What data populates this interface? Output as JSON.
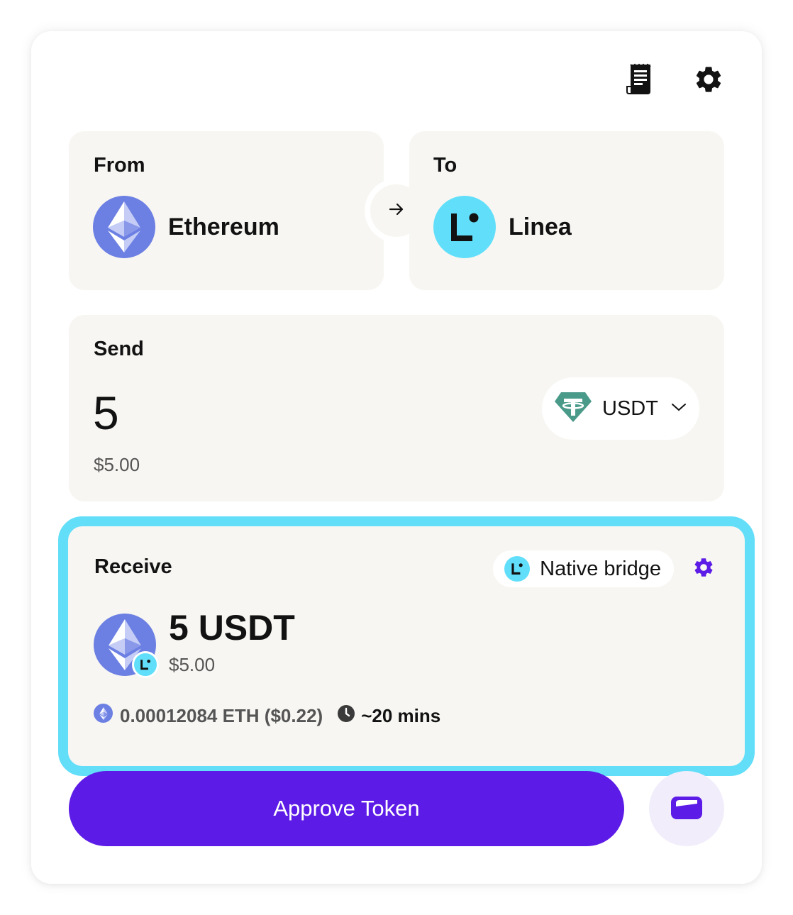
{
  "header": {
    "history_icon": "receipt-icon",
    "settings_icon": "gear-icon"
  },
  "from": {
    "label": "From",
    "chain_name": "Ethereum",
    "chain_icon": "ethereum-logo-icon"
  },
  "swap": {
    "icon": "arrow-right-icon"
  },
  "to": {
    "label": "To",
    "chain_name": "Linea",
    "chain_icon": "linea-logo-icon"
  },
  "send": {
    "label": "Send",
    "amount": "5",
    "usd_value": "$5.00",
    "token_symbol": "USDT",
    "token_icon": "tether-logo-icon",
    "dropdown_icon": "chevron-down-icon"
  },
  "receive": {
    "label": "Receive",
    "route_name": "Native bridge",
    "route_icon": "linea-logo-icon",
    "route_settings_icon": "gear-icon",
    "amount": "5 USDT",
    "usd_value": "$5.00",
    "fee": "0.00012084 ETH ($0.22)",
    "fee_icon": "ethereum-logo-icon",
    "eta": "~20 mins",
    "eta_icon": "clock-icon"
  },
  "actions": {
    "approve_label": "Approve Token",
    "wallet_icon": "wallet-icon"
  },
  "colors": {
    "accent": "#5c1be6",
    "receive_border": "#62def9",
    "panel_bg": "#f7f6f2",
    "ethereum": "#6c7fe3",
    "linea": "#61dffa",
    "tether": "#4a9a8a"
  }
}
